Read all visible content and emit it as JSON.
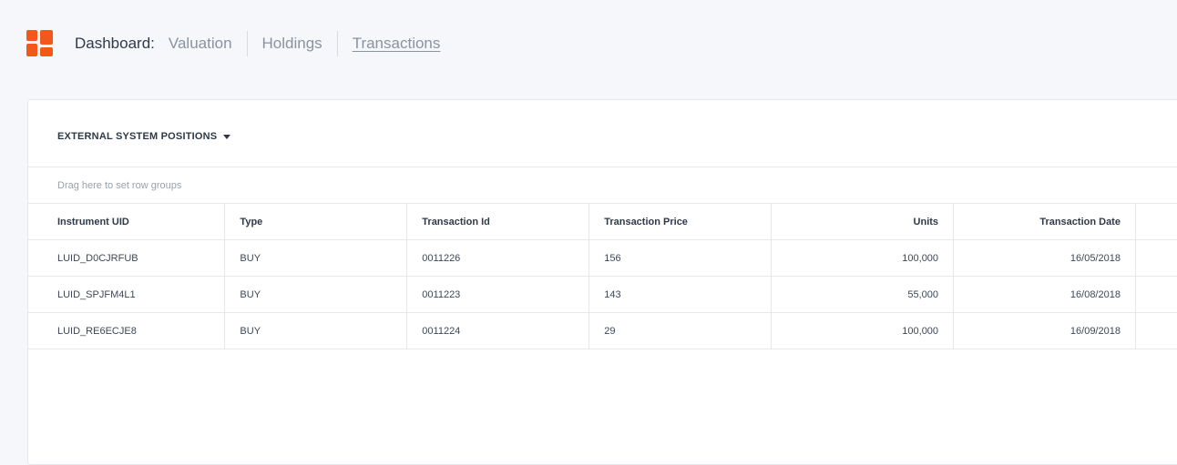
{
  "colors": {
    "accent": "#f2581c"
  },
  "logo": {
    "icon": "dashboard-grid-icon"
  },
  "nav": {
    "title": "Dashboard:",
    "items": [
      {
        "label": "Valuation",
        "active": false
      },
      {
        "label": "Holdings",
        "active": false
      },
      {
        "label": "Transactions",
        "active": true
      }
    ]
  },
  "panel": {
    "dropdown_label": "EXTERNAL SYSTEM POSITIONS",
    "dropdown_icon": "caret-down-icon",
    "row_groups_hint": "Drag here to set row groups"
  },
  "table": {
    "columns": [
      "Instrument UID",
      "Type",
      "Transaction Id",
      "Transaction Price",
      "Units",
      "Transaction Date"
    ],
    "rows": [
      [
        "LUID_D0CJRFUB",
        "BUY",
        "0011226",
        "156",
        "100,000",
        "16/05/2018"
      ],
      [
        "LUID_SPJFM4L1",
        "BUY",
        "0011223",
        "143",
        "55,000",
        "16/08/2018"
      ],
      [
        "LUID_RE6ECJE8",
        "BUY",
        "0011224",
        "29",
        "100,000",
        "16/09/2018"
      ]
    ]
  }
}
